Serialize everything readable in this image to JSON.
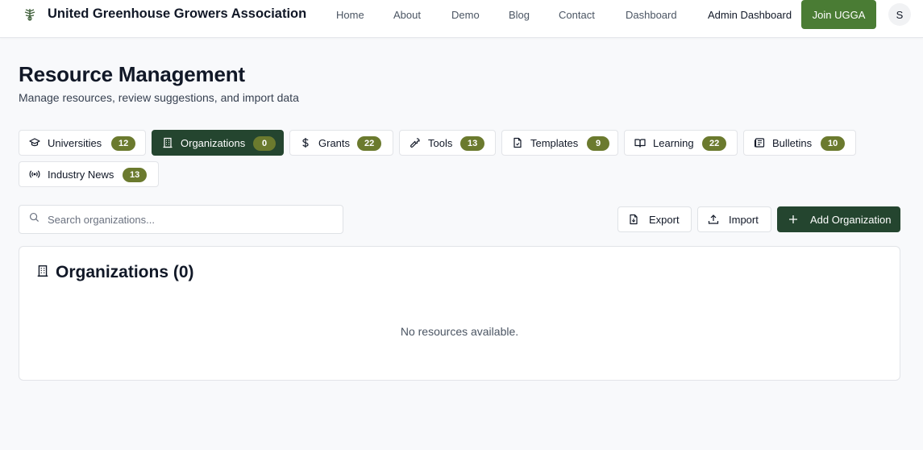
{
  "header": {
    "brand_name": "United Greenhouse Growers Association",
    "nav": {
      "home": "Home",
      "about": "About",
      "demo": "Demo",
      "blog": "Blog",
      "contact": "Contact",
      "dashboard": "Dashboard",
      "admin_dashboard": "Admin Dashboard"
    },
    "join_label": "Join UGGA",
    "avatar_initial": "S"
  },
  "page": {
    "title": "Resource Management",
    "subtitle": "Manage resources, review suggestions, and import data"
  },
  "tabs": [
    {
      "label": "Universities",
      "count": "12",
      "icon": "graduation-cap-icon",
      "active": false
    },
    {
      "label": "Organizations",
      "count": "0",
      "icon": "building-icon",
      "active": true
    },
    {
      "label": "Grants",
      "count": "22",
      "icon": "dollar-icon",
      "active": false
    },
    {
      "label": "Tools",
      "count": "13",
      "icon": "wrench-icon",
      "active": false
    },
    {
      "label": "Templates",
      "count": "9",
      "icon": "file-icon",
      "active": false
    },
    {
      "label": "Learning",
      "count": "22",
      "icon": "book-icon",
      "active": false
    },
    {
      "label": "Bulletins",
      "count": "10",
      "icon": "newspaper-icon",
      "active": false
    },
    {
      "label": "Industry News",
      "count": "13",
      "icon": "radio-icon",
      "active": false
    }
  ],
  "toolbar": {
    "search_placeholder": "Search organizations...",
    "search_value": "",
    "export_label": "Export",
    "import_label": "Import",
    "add_label": "Add Organization"
  },
  "card": {
    "title": "Organizations (0)",
    "empty_text": "No resources available."
  },
  "colors": {
    "brand_green": "#4a7c34",
    "dark_green": "#24452f",
    "badge_olive": "#6b7a2e"
  }
}
